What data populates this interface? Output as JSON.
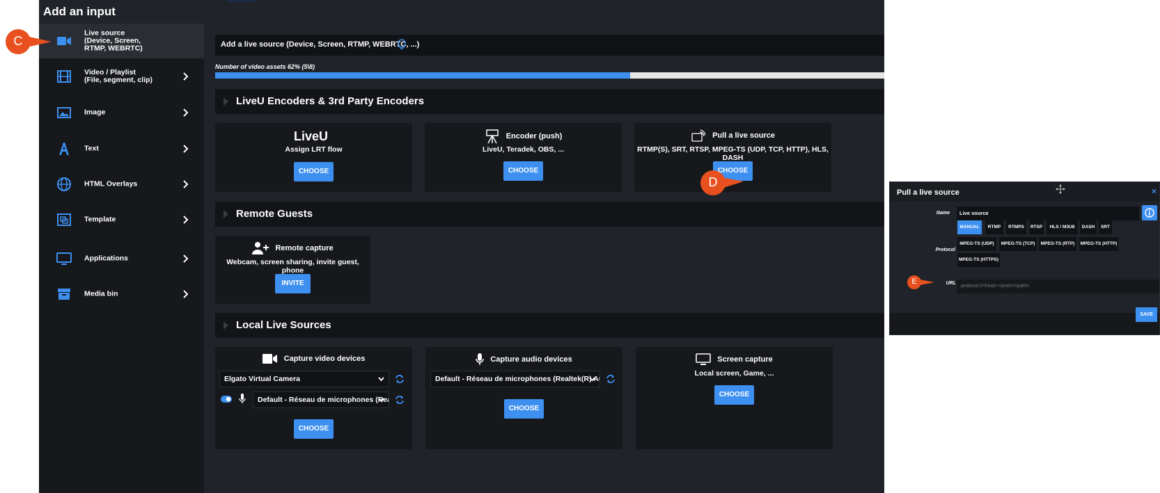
{
  "app": {
    "title": "Add an input"
  },
  "sidebar": {
    "items": [
      {
        "label": "Live source\n(Device, Screen,\nRTMP, WEBRTC)",
        "icon": "video-camera-icon",
        "active": true
      },
      {
        "label": "Video / Playlist\n(File, segment, clip)",
        "icon": "film-icon"
      },
      {
        "label": "Image",
        "icon": "image-icon"
      },
      {
        "label": "Text",
        "icon": "text-icon"
      },
      {
        "label": "HTML Overlays",
        "icon": "globe-icon"
      },
      {
        "label": "Template",
        "icon": "template-icon"
      },
      {
        "label": "Applications",
        "icon": "monitor-icon"
      },
      {
        "label": "Media bin",
        "icon": "archive-icon"
      }
    ]
  },
  "main": {
    "info_text": "Add a live source (Device, Screen, RTMP, WEBRTC, ...)",
    "progress": {
      "label": "Number of video assets 62% (5\\8)",
      "percent": 62
    },
    "sections": {
      "encoders": "LiveU Encoders & 3rd Party Encoders",
      "guests": "Remote Guests",
      "local": "Local Live Sources"
    },
    "cards": {
      "liveu": {
        "logo": "LiveU",
        "subtitle": "Assign LRT flow",
        "button": "CHOOSE"
      },
      "encoder": {
        "title": "Encoder (push)",
        "subtitle": "LiveU, Teradek, OBS, ...",
        "button": "CHOOSE"
      },
      "pull": {
        "title": "Pull a live source",
        "subtitle": "RTMP(S), SRT, RTSP, MPEG-TS (UDP, TCP, HTTP), HLS, DASH",
        "button": "CHOOSE"
      },
      "remote": {
        "title": "Remote capture",
        "subtitle": "Webcam, screen sharing, invite guest, phone",
        "button": "INVITE"
      },
      "video_devices": {
        "title": "Capture video devices",
        "select1": "Elgato Virtual Camera",
        "select2": "Default - Réseau de microphones (Realtek(R) Audio)",
        "button": "CHOOSE"
      },
      "audio_devices": {
        "title": "Capture audio devices",
        "select": "Default - Réseau de microphones (Realtek(R) Audio)",
        "button": "CHOOSE"
      },
      "screen": {
        "title": "Screen capture",
        "subtitle": "Local screen, Game, ...",
        "button": "CHOOSE"
      }
    }
  },
  "dialog": {
    "title": "Pull a live source",
    "close": "×",
    "name_label": "Name",
    "name_value": "Live source",
    "protocol_label": "Protocol",
    "protocols": [
      "MANUAL",
      "RTMP",
      "RTMPS",
      "RTSP",
      "HLS / M3U8",
      "DASH",
      "SRT",
      "MPEG-TS (UDP)",
      "MPEG-TS (TCP)",
      "MPEG-TS (RTP)",
      "MPEG-TS (HTTP)",
      "MPEG-TS (HTTPS)"
    ],
    "selected_protocol": "MANUAL",
    "url_label": "URL",
    "url_placeholder": "protocol://<host>:<port>/<path>",
    "save": "SAVE"
  },
  "callouts": {
    "c": "C",
    "d": "D",
    "e": "E"
  },
  "colors": {
    "accent": "#3d8ff0",
    "callout": "#e8501f",
    "bg": "#202329",
    "sidebar": "#16181c"
  }
}
